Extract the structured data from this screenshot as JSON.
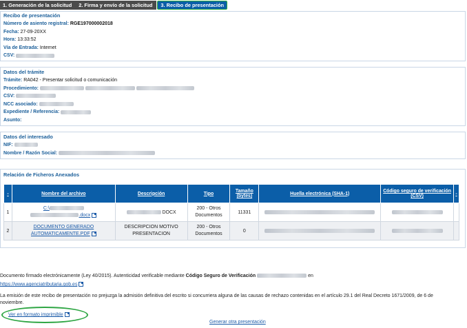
{
  "steps": [
    {
      "label": "1. Generación de la solicitud"
    },
    {
      "label": "2. Firma y envío de la solicitud"
    },
    {
      "label": "3. Recibo de presentación"
    }
  ],
  "recibo": {
    "title": "Recibo de presentación",
    "asiento_label": "Número de asiento registral:",
    "asiento_value": "RGE197000002018",
    "fecha_label": "Fecha:",
    "fecha_value": "27-09-20XX",
    "hora_label": "Hora:",
    "hora_value": "13:33:52",
    "via_label": "Vía de Entrada:",
    "via_value": "Internet",
    "csv_label": "CSV:"
  },
  "tramite": {
    "title": "Datos del trámite",
    "tramite_label": "Trámite:",
    "tramite_value": "RA042 - Presentar solicitud o comunicación",
    "procedimiento_label": "Procedimiento:",
    "csv_label": "CSV:",
    "ncc_label": "NCC asociado:",
    "expediente_label": "Expediente / Referencia:",
    "asunto_label": "Asunto:"
  },
  "interesado": {
    "title": "Datos del interesado",
    "nif_label": "NIF:",
    "nombre_label": "Nombre / Razón Social:"
  },
  "ficheros": {
    "title": "Relación de Ficheros Anexados",
    "columns": {
      "dash_left": "-",
      "nombre": "Nombre del archivo",
      "descripcion": "Descripción",
      "tipo": "Tipo",
      "tamano": "Tamaño (bytes)",
      "huella": "Huella electrónica (SHA-1)",
      "csv": "Código seguro de verificación (CSV)",
      "dash_right": "-"
    },
    "rows": [
      {
        "num": "1",
        "name_prefix": "C:\\",
        "name_suffix": ".docx",
        "desc_suffix": "DOCX",
        "tipo": "200 - Otros Documentos",
        "size": "11331"
      },
      {
        "num": "2",
        "name": "DOCUMENTO GENERADO AUTOMATICAMENTE.PDF",
        "desc": "DESCRIPCION MOTIVO PRESENTACION",
        "tipo": "200 - Otros Documentos",
        "size": "0"
      }
    ]
  },
  "footer": {
    "firmado_text": "Documento firmado electrónicamente (Ley 40/2015). Autenticidad verificable mediante ",
    "csv_text": "Código Seguro de Verificación",
    "en_text": "en",
    "url": "https://www.agenciatributaria.gob.es",
    "disclaimer_line1": "La emisión de este recibo de presentación no prejuzga la admisión definitiva del escrito si concurriera alguna de las causas de rechazo contenidas en el artículo 29.1 del Real Decreto 1671/2009, de 6 de",
    "disclaimer_line2": "noviembre.",
    "ver_imprimible": "Ver en formato imprimible",
    "generar_otra": "Generar otra presentación"
  },
  "colors": {
    "header_blue": "#0b5ea8",
    "label_blue": "#1a5e99",
    "highlight_green": "#2fa644"
  }
}
